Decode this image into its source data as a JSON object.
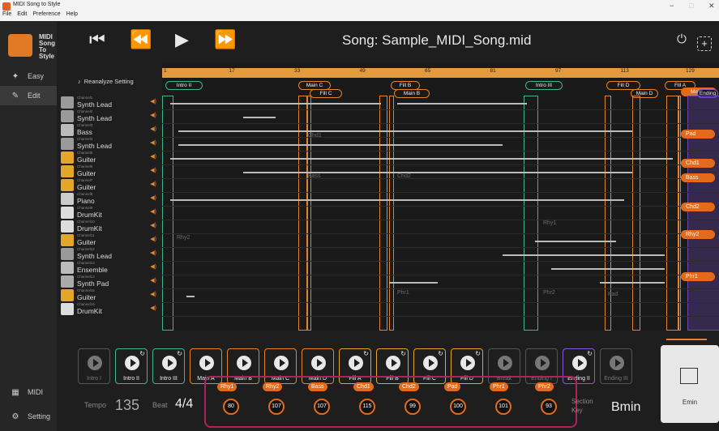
{
  "window": {
    "title": "MIDI Song to Style",
    "menus": [
      "File",
      "Edit",
      "Preference",
      "Help"
    ],
    "controls": [
      "−",
      "□",
      "✕"
    ]
  },
  "sidebar": {
    "logo_text": "MIDI\nSong\nTo\nStyle",
    "items": [
      {
        "label": "Easy",
        "icon": "wand-icon"
      },
      {
        "label": "Edit",
        "icon": "edit-icon"
      },
      {
        "label": "MIDI",
        "icon": "midi-icon"
      },
      {
        "label": "Setting",
        "icon": "gear-icon"
      }
    ]
  },
  "transport": {
    "song_title": "Song: Sample_MIDI_Song.mid"
  },
  "tracks": {
    "reanalyze_label": "Reanalyze Setting",
    "list": [
      {
        "channel": "Channel1",
        "name": "Synth Lead"
      },
      {
        "channel": "Channel2",
        "name": "Synth Lead"
      },
      {
        "channel": "Channel3",
        "name": "Bass"
      },
      {
        "channel": "Channel4",
        "name": "Synth Lead"
      },
      {
        "channel": "Channel5",
        "name": "Guiter"
      },
      {
        "channel": "Channel6",
        "name": "Guiter"
      },
      {
        "channel": "Channel7",
        "name": "Guiter"
      },
      {
        "channel": "Channel8",
        "name": "Piano"
      },
      {
        "channel": "Channel9",
        "name": "DrumKit"
      },
      {
        "channel": "Channel10",
        "name": "DrumKit"
      },
      {
        "channel": "Channel11",
        "name": "Guiter"
      },
      {
        "channel": "Channel12",
        "name": "Synth Lead"
      },
      {
        "channel": "Channel13",
        "name": "Ensemble"
      },
      {
        "channel": "Channel14",
        "name": "Synth Pad"
      },
      {
        "channel": "Channel15",
        "name": "Guiter"
      },
      {
        "channel": "Channel16",
        "name": "DrumKit"
      }
    ]
  },
  "timeline": {
    "ruler_numbers": [
      "1",
      "17",
      "33",
      "49",
      "65",
      "81",
      "97",
      "113",
      "129"
    ],
    "sections": [
      {
        "label": "Intro II",
        "color": "#3fb58a"
      },
      {
        "label": "Main C",
        "color": "#e3832a"
      },
      {
        "label": "Fill C",
        "color": "#e3832a"
      },
      {
        "label": "Fill B",
        "color": "#e3832a"
      },
      {
        "label": "Main B",
        "color": "#e3832a"
      },
      {
        "label": "Intro III",
        "color": "#3fb58a"
      },
      {
        "label": "Fill D",
        "color": "#e3832a"
      },
      {
        "label": "Main D",
        "color": "#e3832a"
      },
      {
        "label": "Fill A",
        "color": "#e3832a"
      },
      {
        "label": "Main A",
        "color": "#e36a1a"
      },
      {
        "label": "Ending",
        "color": "#8a5ad8"
      }
    ],
    "part_labels": [
      "Pad",
      "Chd1",
      "Bass",
      "Chd2",
      "Rhy2",
      "Phr1"
    ],
    "ghost_labels": [
      "Chd1",
      "Bass",
      "Chd2",
      "Rhy2",
      "Rhy1",
      "Phr1",
      "Phr2",
      "Pad"
    ]
  },
  "pads": [
    {
      "label": "Intro I",
      "state": "disabled",
      "color": "#555555"
    },
    {
      "label": "Intro II",
      "state": "on",
      "color": "#3fb58a"
    },
    {
      "label": "Intro III",
      "state": "on",
      "color": "#3fb58a"
    },
    {
      "label": "Main A",
      "state": "on",
      "color": "#e3832a"
    },
    {
      "label": "Main B",
      "state": "on",
      "color": "#e3832a"
    },
    {
      "label": "Main C",
      "state": "on",
      "color": "#e3832a"
    },
    {
      "label": "Main D",
      "state": "on",
      "color": "#e3832a"
    },
    {
      "label": "Fill A",
      "state": "on",
      "color": "#e3a52a"
    },
    {
      "label": "Fill B",
      "state": "on",
      "color": "#e3a52a"
    },
    {
      "label": "Fill C",
      "state": "on",
      "color": "#e3a52a"
    },
    {
      "label": "Fill D",
      "state": "on",
      "color": "#e3a52a"
    },
    {
      "label": "Break",
      "state": "disabled",
      "color": "#555555"
    },
    {
      "label": "Ending I",
      "state": "disabled",
      "color": "#555555"
    },
    {
      "label": "Ending II",
      "state": "on",
      "color": "#8a5ad8"
    },
    {
      "label": "Ending III",
      "state": "disabled",
      "color": "#555555"
    }
  ],
  "footer": {
    "tempo_label": "Tempo",
    "tempo_value": "135",
    "beat_label": "Beat",
    "beat_value": "4/4",
    "section_label": "Section",
    "key_label": "Key",
    "key_value": "Bmin",
    "chord_label": "Emin",
    "mixer": [
      {
        "part": "Rhy1",
        "value": "80"
      },
      {
        "part": "Rhy2",
        "value": "107"
      },
      {
        "part": "Bass",
        "value": "107"
      },
      {
        "part": "Chd1",
        "value": "115"
      },
      {
        "part": "Chd2",
        "value": "99"
      },
      {
        "part": "Pad",
        "value": "100"
      },
      {
        "part": "Phr1",
        "value": "101"
      },
      {
        "part": "Phr2",
        "value": "93"
      }
    ]
  }
}
